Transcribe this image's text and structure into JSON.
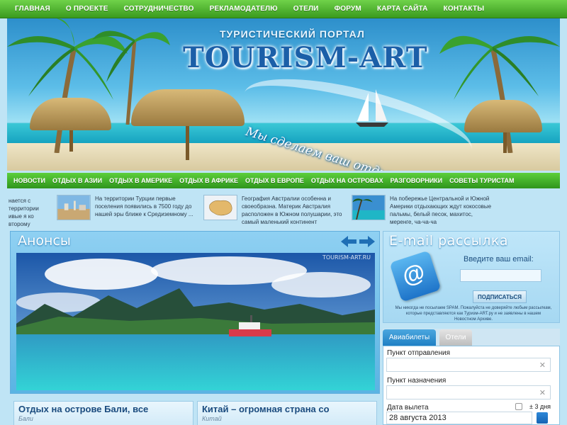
{
  "top_nav": [
    "ГЛАВНАЯ",
    "О ПРОЕКТЕ",
    "СОТРУДНИЧЕСТВО",
    "РЕКЛАМОДАТЕЛЮ",
    "ОТЕЛИ",
    "ФОРУМ",
    "КАРТА САЙТА",
    "КОНТАКТЫ"
  ],
  "banner": {
    "subtitle": "ТУРИСТИЧЕСКИЙ ПОРТАЛ",
    "title": "TOURISM-ART",
    "slogan": "Мы сделаем ваш отдых ярче!"
  },
  "category_nav": [
    "НОВОСТИ",
    "ОТДЫХ В АЗИИ",
    "ОТДЫХ В АМЕРИКЕ",
    "ОТДЫХ В АФРИКЕ",
    "ОТДЫХ В ЕВРОПЕ",
    "ОТДЫХ НА ОСТРОВАХ",
    "РАЗГОВОРНИКИ",
    "СОВЕТЫ ТУРИСТАМ"
  ],
  "ticker": {
    "partial": "нается с территории ивые я ко второму",
    "items": [
      {
        "text": "На территории Турции первые поселения появились в 7500 году до нашей эры ближе к Средиземному ..."
      },
      {
        "text": "География Австралии особенна и своеобразна. Материк Австралия расположен в Южном полушарии, это самый маленький континент"
      },
      {
        "text": "На побережье Центральной и Южной Америки отдыхающих ждут кокосовые пальмы, белый песок, махитос, меренге, ча-ча-ча"
      }
    ]
  },
  "anons": {
    "title": "Анонсы",
    "watermark": "TOURISM-ART.RU",
    "prev_icon": "arrow-left-icon",
    "next_icon": "arrow-right-icon"
  },
  "articles": [
    {
      "title": "Отдых на острове Бали, все",
      "tag": "Бали"
    },
    {
      "title": "Китай – огромная страна со",
      "tag": "Китай"
    }
  ],
  "mailing": {
    "title": "E-mail рассылка",
    "label": "Введите ваш email:",
    "button": "ПОДПИСАТЬСЯ",
    "note": "Мы никогда не посылаем SPAM. Пожалуйста не доверяйте любым рассылкам, которые представляются как Туризм-ART.ру и не заявлены в нашем Новостном Архиве."
  },
  "booking": {
    "tabs": [
      "Авиабилеты",
      "Отели"
    ],
    "from_label": "Пункт отправления",
    "to_label": "Пункт назначения",
    "date_label": "Дата вылета",
    "flex_label": "± 3 дня",
    "date_value": "28 августа 2013"
  },
  "colors": {
    "nav_green": "#3a9a1e",
    "accent_blue": "#1f80c4",
    "page_bg": "#bfe4f5"
  }
}
